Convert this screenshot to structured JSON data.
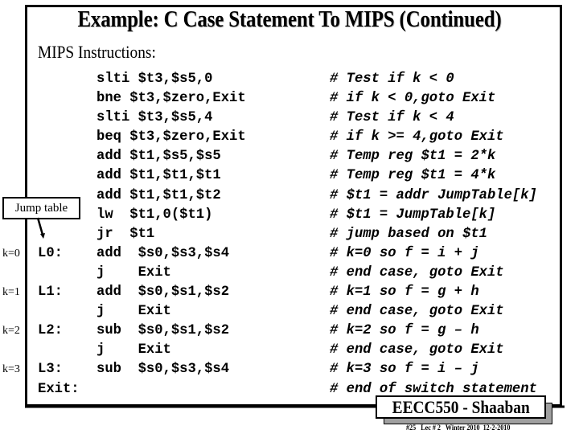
{
  "slide": {
    "title": "Example: C Case Statement To MIPS (Continued)",
    "subtitle": "MIPS Instructions:"
  },
  "jump_table": {
    "label": "Jump table"
  },
  "case_labels": [
    {
      "row": 9,
      "text": "k=0"
    },
    {
      "row": 11,
      "text": "k=1"
    },
    {
      "row": 13,
      "text": "k=2"
    },
    {
      "row": 15,
      "text": "k=3"
    }
  ],
  "rows": [
    {
      "label": "",
      "instr": "slti $t3,$s5,0",
      "comment": "# Test if k < 0"
    },
    {
      "label": "",
      "instr": "bne $t3,$zero,Exit",
      "comment": "# if k < 0,goto Exit"
    },
    {
      "label": "",
      "instr": "slti $t3,$s5,4",
      "comment": "# Test if k < 4"
    },
    {
      "label": "",
      "instr": "beq $t3,$zero,Exit",
      "comment": "# if k >= 4,goto Exit"
    },
    {
      "label": "",
      "instr": "add $t1,$s5,$s5",
      "comment": "# Temp reg $t1 = 2*k"
    },
    {
      "label": "",
      "instr": "add $t1,$t1,$t1",
      "comment": "# Temp reg $t1 = 4*k"
    },
    {
      "label": "",
      "instr": "add $t1,$t1,$t2",
      "comment": "# $t1 = addr JumpTable[k]"
    },
    {
      "label": "",
      "instr": "lw  $t1,0($t1)",
      "comment": "# $t1 = JumpTable[k]"
    },
    {
      "label": "",
      "instr": "jr  $t1",
      "comment": "# jump based on $t1"
    },
    {
      "label": "L0:",
      "instr": "add  $s0,$s3,$s4",
      "comment": "# k=0 so f = i + j"
    },
    {
      "label": "",
      "instr": "j    Exit",
      "comment": "# end case, goto Exit"
    },
    {
      "label": "L1:",
      "instr": "add  $s0,$s1,$s2",
      "comment": "# k=1 so f = g + h"
    },
    {
      "label": "",
      "instr": "j    Exit",
      "comment": "# end case, goto Exit"
    },
    {
      "label": "L2:",
      "instr": "sub  $s0,$s1,$s2",
      "comment": "# k=2 so f = g – h"
    },
    {
      "label": "",
      "instr": "j    Exit",
      "comment": "# end case, goto Exit"
    },
    {
      "label": "L3:",
      "instr": "sub  $s0,$s3,$s4",
      "comment": "# k=3 so f = i – j"
    },
    {
      "label": "Exit:",
      "instr": "",
      "comment": "# end of switch statement"
    }
  ],
  "badge": {
    "text": "EECC550 - Shaaban"
  },
  "footer": {
    "text": "#25   Lec # 2   Winter 2010  12-2-2010"
  }
}
